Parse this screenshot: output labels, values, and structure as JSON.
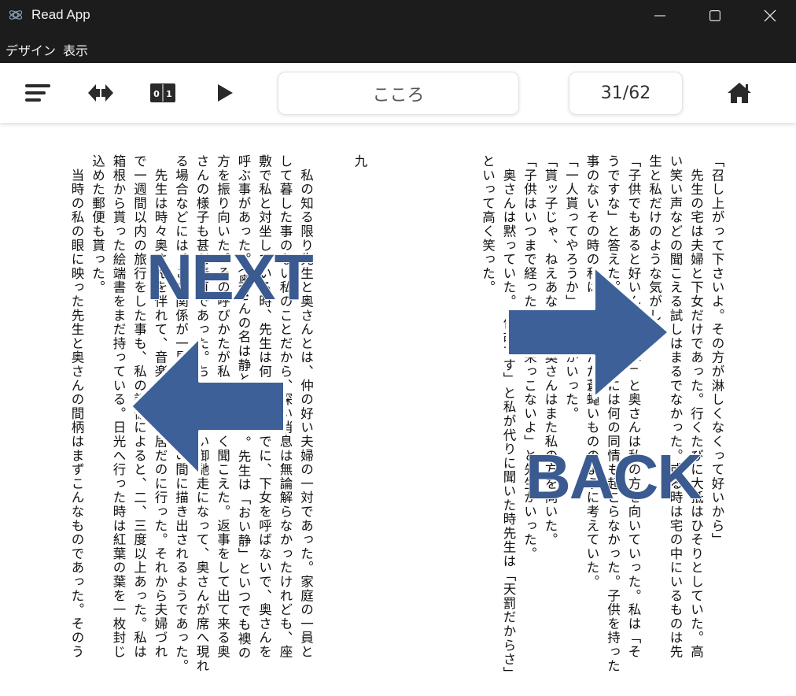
{
  "window": {
    "title": "Read App",
    "controls": [
      "minimize-icon",
      "maximize-icon",
      "close-icon"
    ]
  },
  "menu": {
    "items": [
      "デザイン",
      "表示"
    ]
  },
  "toolbar": {
    "icons": [
      "menu-icon",
      "swap-icon",
      "page-icon",
      "play-icon",
      "home-icon"
    ],
    "book_title": "こころ",
    "page_indicator": "31/62"
  },
  "page_right": {
    "columns": [
      "「召し上がって下さいよ。その方が淋しくなくって好いから」",
      "　先生の宅は夫婦と下女だけであった。行くたびに大抵はひそりとしていた。高",
      "い笑い声などの聞こえる試しはまるでなかった。或る時は宅の中にいるものは先",
      "生と私だけのような気がした。",
      "「子供でもあると好いんですがね」と奥さんは私の方を向いていった。私は「そ",
      "うですな」と答えた。しかし私の心には何の同情も起こらなかった。子供を持った",
      "事のないその時の私は、子供をただ蒼蠅いもののように考えていた。",
      "「一人貰ってやろうか」と先生がいった。",
      "「貰ッ子じゃ、ねえあなた」と奥さんはまた私の方を向いた。",
      "「子供はいつまで経ったって出来っこないよ」と先生がいった。",
      "　奥さんは黙っていた。「何故です」と私が代りに聞いた時先生は「天罰だからさ」",
      "といって高く笑った。"
    ]
  },
  "page_left": {
    "chapter": "九",
    "columns": [
      "　私の知る限り先生と奥さんとは、仲の好い夫婦の一対であった。家庭の一員と",
      "して暮した事のない私のことだから、深い消息は無論解らなかったけれども、座",
      "敷で私と対坐している時、先生は何かのついでに、下女を呼ばないで、奥さんを",
      "呼ぶ事があった。（奥さんの名は静といった）。先生は「おい静」といつでも襖の",
      "方を振り向いた。その呼びかたが私には優しく聞こえた。返事をして出て来る奥",
      "さんの様子も甚だ素直であった。ちょいちょい御馳走になって、奥さんが席へ現れ",
      "る場合などには、この関係が一層明らかに二人の間に描き出されるようであった。",
      "　先生は時々奥さんを伴れて、音楽会だの芝居だのに行った。それから夫婦づれ",
      "で一週間以内の旅行をした事も、私の記憶によると、二、三度以上あった。私は",
      "箱根から貰った絵端書をまだ持っている。日光へ行った時は紅葉の葉を一枚封じ",
      "込めた郵便も貰った。",
      "　当時の私の眼に映った先生と奥さんの間柄はまずこんなものであった。そのう"
    ]
  },
  "overlay": {
    "next_label": "NEXT",
    "back_label": "BACK",
    "arrow_color": "#3d6098"
  }
}
